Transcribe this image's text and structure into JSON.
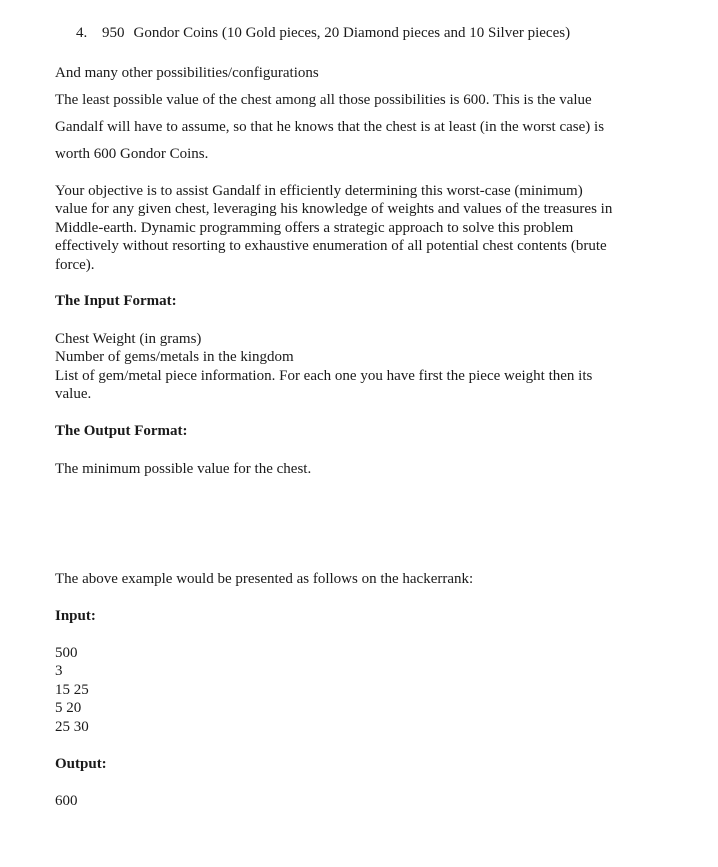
{
  "list_item": {
    "number": "4.",
    "amount": "950",
    "text": "Gondor Coins (10 Gold pieces, 20 Diamond pieces and 10 Silver pieces)"
  },
  "intro": {
    "possibilities": "And many other possibilities/configurations",
    "least_line1": "The least possible value of the chest among all those possibilities is 600. This is the value",
    "least_line2": "Gandalf will have to assume, so that he knows that the chest is at least (in the worst case) is",
    "least_line3": "worth 600 Gondor Coins."
  },
  "objective": {
    "line1": "Your objective is to assist Gandalf in efficiently determining this worst-case (minimum)",
    "line2": "value for any given chest, leveraging his knowledge of weights and values of the treasures in",
    "line3": "Middle-earth. Dynamic programming offers a strategic approach to solve this problem",
    "line4": "effectively without resorting to exhaustive enumeration of all potential chest contents (brute",
    "line5": "force)."
  },
  "input_format": {
    "heading": "The Input Format:",
    "line1": "Chest Weight (in grams)",
    "line2": "Number of gems/metals in the kingdom",
    "line3": "List of gem/metal piece information. For each one you have first the piece weight then its",
    "line4": "value."
  },
  "output_format": {
    "heading": "The Output Format:",
    "line1": "The minimum possible value for the chest."
  },
  "example": {
    "intro": "The above example would be presented as follows on the hackerrank:",
    "input_heading": "Input:",
    "input_lines": [
      "500",
      "3",
      "15 25",
      "5 20",
      "25 30"
    ],
    "output_heading": "Output:",
    "output_value": "600"
  }
}
